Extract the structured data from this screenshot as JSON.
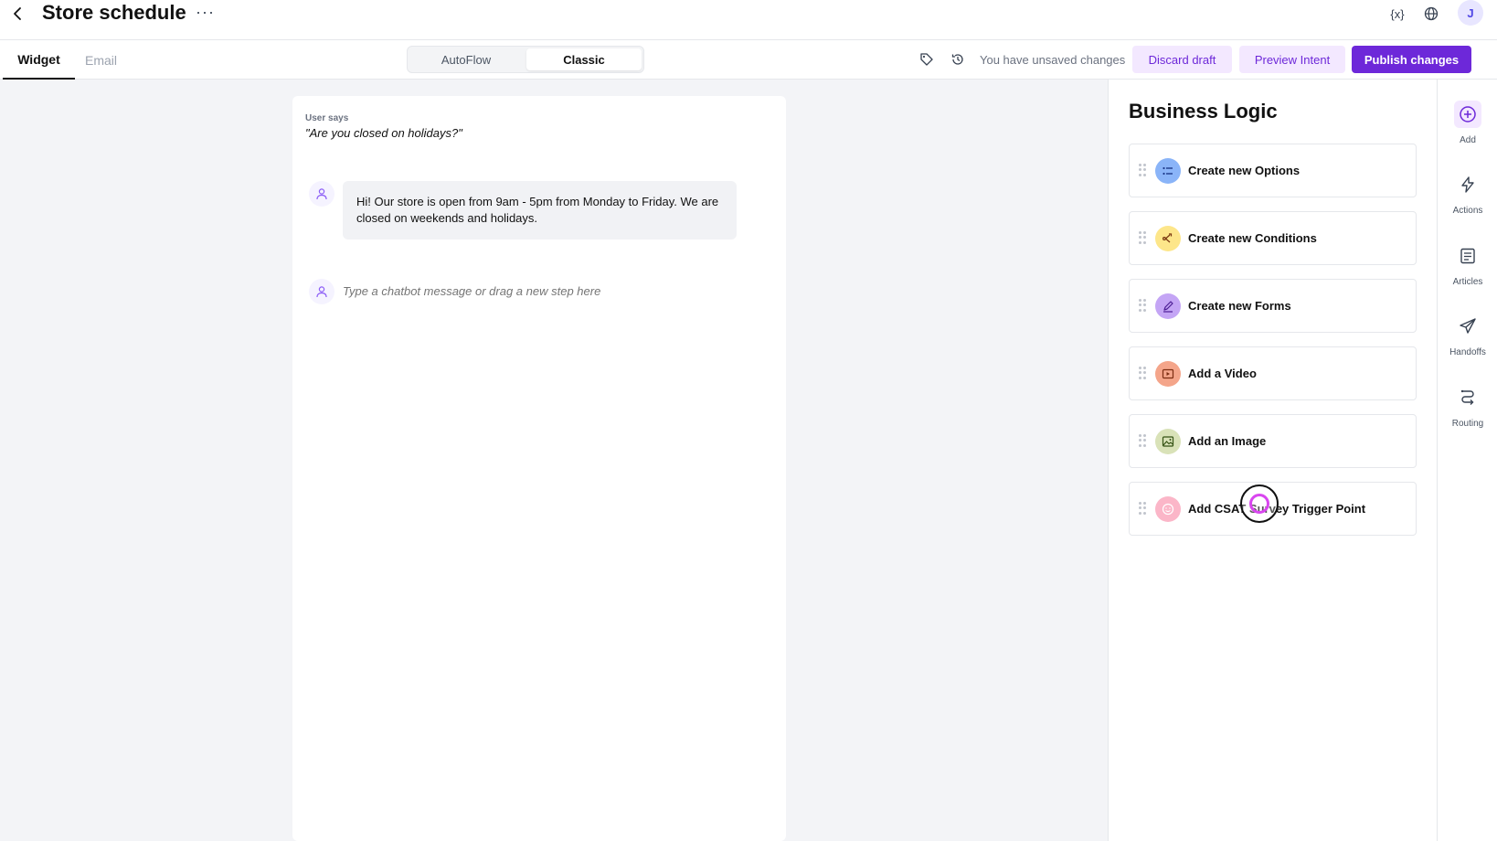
{
  "header": {
    "title": "Store schedule",
    "more_label": "···",
    "variables_label": "{x}",
    "avatar_initial": "J"
  },
  "toolbar": {
    "tabs": [
      "Widget",
      "Email"
    ],
    "segment": [
      "AutoFlow",
      "Classic"
    ],
    "selected_segment": "Classic",
    "unsaved_text": "You have unsaved changes",
    "discard_label": "Discard draft",
    "preview_label": "Preview Intent",
    "publish_label": "Publish changes"
  },
  "chat": {
    "user_says_label": "User says",
    "user_says_text": "\"Are you closed on holidays?\"",
    "bot_message": "Hi! Our store is open from 9am - 5pm from Monday to Friday. We are closed on weekends and holidays.",
    "input_placeholder": "Type a chatbot message or drag a new step here"
  },
  "logic": {
    "title": "Business Logic",
    "items": [
      {
        "label": "Create new Options",
        "icon": "list-icon",
        "color": "#8ab4f8"
      },
      {
        "label": "Create new Conditions",
        "icon": "branch-icon",
        "color": "#fde68a"
      },
      {
        "label": "Create new Forms",
        "icon": "pen-icon",
        "color": "#c4a5f5"
      },
      {
        "label": "Add a Video",
        "icon": "video-icon",
        "color": "#f4a58a"
      },
      {
        "label": "Add an Image",
        "icon": "image-icon",
        "color": "#d9e2b8"
      },
      {
        "label": "Add CSAT Survey Trigger Point",
        "icon": "smile-icon",
        "color": "#fbb6c8"
      }
    ]
  },
  "rail": {
    "items": [
      {
        "label": "Add",
        "icon": "plus-circle-icon"
      },
      {
        "label": "Actions",
        "icon": "lightning-icon"
      },
      {
        "label": "Articles",
        "icon": "document-icon"
      },
      {
        "label": "Handoffs",
        "icon": "send-icon"
      },
      {
        "label": "Routing",
        "icon": "routing-icon"
      }
    ]
  },
  "colors": {
    "accent": "#6d28d9",
    "accent_light": "#f3e8ff",
    "canvas_bg": "#f3f4f7"
  }
}
